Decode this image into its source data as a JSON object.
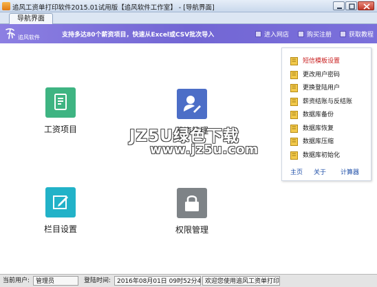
{
  "window": {
    "title": "追风工资单打印软件2015.01试用版【追风软件工作室】 - [导航界面]"
  },
  "tabs": [
    {
      "label": "导航界面"
    }
  ],
  "header": {
    "logo_text": "追风软件",
    "slogan": "支持多达80个薪资项目，快速从Excel或CSV批次导入",
    "links": [
      {
        "label": "进入网店"
      },
      {
        "label": "购买注册"
      },
      {
        "label": "获取教程"
      }
    ],
    "banner_color": "#7b6fdc"
  },
  "tiles": [
    {
      "label": "工资项目",
      "icon": "document-icon",
      "color": "#3eb482"
    },
    {
      "label": "薪资管理",
      "icon": "user-edit-icon",
      "color": "#4c6ec7"
    },
    {
      "label": "栏目设置",
      "icon": "edit-icon",
      "color": "#22b2c8"
    },
    {
      "label": "权限管理",
      "icon": "lock-icon",
      "color": "#7e8387"
    }
  ],
  "watermark": {
    "line1": "JZ5U绿色下载",
    "line2": "www.jz5u.com"
  },
  "quick_menu": {
    "items": [
      {
        "label": "短信模板设置",
        "icon": "folder-icon"
      },
      {
        "label": "更改用户密码",
        "icon": "folder-icon"
      },
      {
        "label": "更换登陆用户",
        "icon": "folder-icon"
      },
      {
        "label": "薪资结账与反结账",
        "icon": "folder-icon"
      },
      {
        "label": "数据库备份",
        "icon": "folder-icon"
      },
      {
        "label": "数据库恢复",
        "icon": "folder-icon"
      },
      {
        "label": "数据库压缩",
        "icon": "folder-icon"
      },
      {
        "label": "数据库初始化",
        "icon": "folder-icon"
      }
    ],
    "links": [
      {
        "label": "主页"
      },
      {
        "label": "关于"
      },
      {
        "label": "计算器"
      }
    ],
    "highlight_color": "#c81e1e"
  },
  "status_bar": {
    "user_label": "当前用户:",
    "user_value": "管理员",
    "login_label": "登陆时间:",
    "login_value": "2016年08月01日 09时52分41秒",
    "welcome": "欢迎您使用追风工资单打印软"
  }
}
